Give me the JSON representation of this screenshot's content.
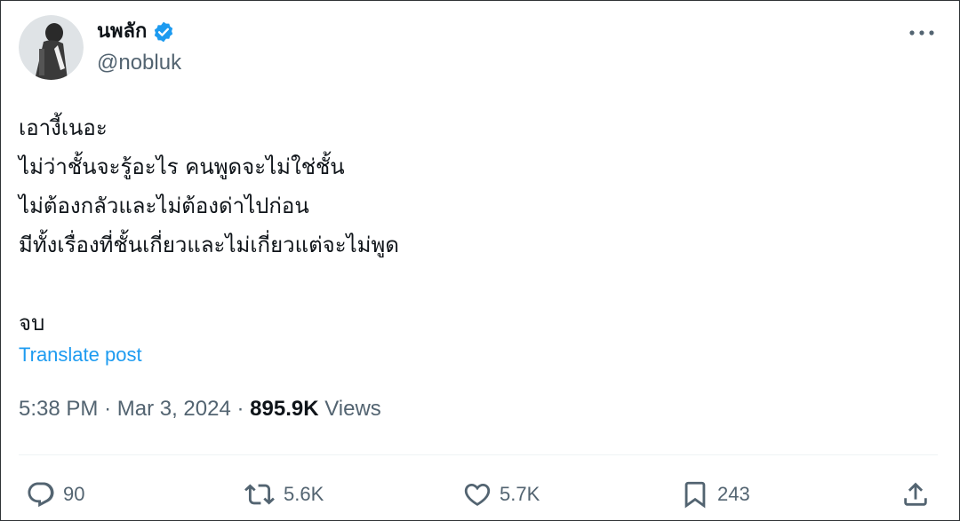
{
  "author": {
    "display_name": "นพลัก",
    "handle": "@nobluk",
    "verified": true
  },
  "post": {
    "lines": [
      "เอางี้เนอะ",
      "ไม่ว่าชั้นจะรู้อะไร คนพูดจะไม่ใช่ชั้น",
      "ไม่ต้องกลัวและไม่ต้องด่าไปก่อน",
      "มีทั้งเรื่องที่ชั้นเกี่ยวและไม่เกี่ยวแต่จะไม่พูด",
      "",
      "จบ"
    ],
    "translate_label": "Translate post"
  },
  "meta": {
    "time": "5:38 PM",
    "separator": "·",
    "date": "Mar 3, 2024",
    "views_count": "895.9K",
    "views_label": "Views"
  },
  "actions": {
    "replies": "90",
    "reposts": "5.6K",
    "likes": "5.7K",
    "bookmarks": "243"
  },
  "colors": {
    "accent": "#1d9bf0",
    "secondary_text": "#536471",
    "primary_text": "#0f1419"
  }
}
